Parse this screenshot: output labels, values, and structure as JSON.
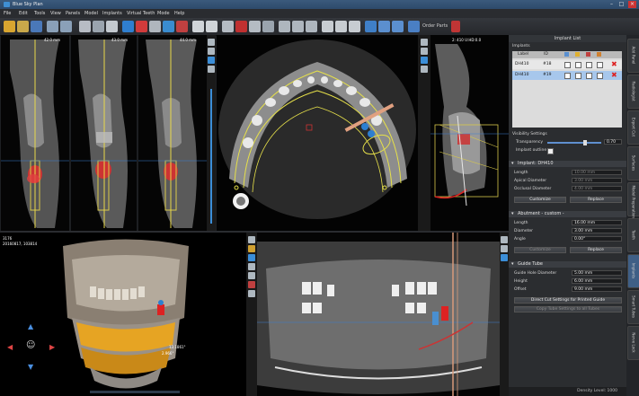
{
  "app": {
    "title": "Blue Sky Plan"
  },
  "menu": [
    "File",
    "Edit",
    "Tools",
    "View",
    "Panels",
    "Model",
    "Implants",
    "Virtual Teeth",
    "Mode",
    "Help"
  ],
  "toolbar": {
    "order_parts": "Order Parts"
  },
  "cross_sections": [
    {
      "measure": "42.0 mm"
    },
    {
      "measure": "43.0 mm"
    },
    {
      "measure": "44.0 mm"
    }
  ],
  "sagittal": {
    "readout": "2: 410  U:HD:0.0"
  },
  "view3d": {
    "info_line1": "3176",
    "info_line2": "20160817, 103814",
    "angle1": "13.1861°",
    "angle2": "2.966°"
  },
  "implant_list": {
    "panel_title": "Implant List",
    "section_title": "Implants",
    "columns": [
      "Label",
      "ID"
    ],
    "rows": [
      {
        "label": "DH410",
        "id": "#18"
      },
      {
        "label": "DH410",
        "id": "#19"
      }
    ]
  },
  "visibility": {
    "title": "Visibility Settings",
    "transparency_label": "Transparency",
    "transparency_value": "0.70",
    "outline_label": "Implant outline"
  },
  "implant": {
    "title": "Implant: DH410",
    "fields": [
      {
        "label": "Length",
        "value": "10.00 mm"
      },
      {
        "label": "Apical Diameter",
        "value": "3.00 mm"
      },
      {
        "label": "Occlusal Diameter",
        "value": "4.00 mm"
      }
    ],
    "customize": "Customize",
    "replace": "Replace"
  },
  "abutment": {
    "title": "Abutment - custom -",
    "fields": [
      {
        "label": "Length",
        "value": "16.00 mm"
      },
      {
        "label": "Diameter",
        "value": "3.00 mm"
      },
      {
        "label": "Angle",
        "value": "0.00°"
      }
    ],
    "customize": "Customize",
    "replace": "Replace"
  },
  "guide_tube": {
    "title": "Guide Tube",
    "fields": [
      {
        "label": "Guide Hole Diameter",
        "value": "5.00 mm"
      },
      {
        "label": "Height",
        "value": "6.00 mm"
      },
      {
        "label": "Offset",
        "value": "9.00 mm"
      }
    ],
    "direct_cut": "Direct Cut Settings for Printed Guide",
    "copy_tube": "Copy Tube Settings to all Tubes"
  },
  "status": {
    "density": "Density Level: 1000"
  },
  "side_tabs": [
    "Add Panel",
    "Radiologist",
    "Export Cut",
    "Surfaces",
    "Model Preparation",
    "Teeth",
    "Implants",
    "Smart Tubes",
    "Nerve Lock"
  ],
  "colors": {
    "accent": "#3f8fd3",
    "bone_yellow": "#e6cc3a",
    "mark_red": "#d22"
  }
}
